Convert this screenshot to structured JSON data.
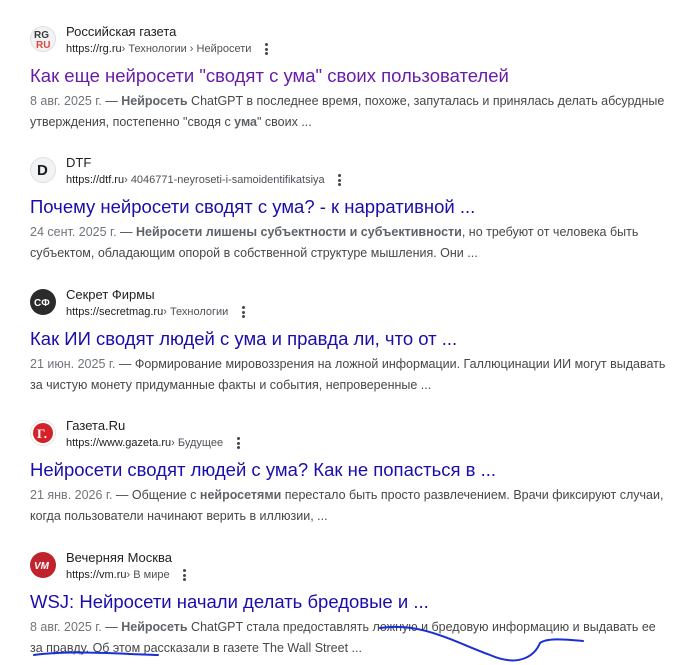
{
  "results": [
    {
      "site": "Российская газета",
      "url": "https://rg.ru",
      "breadcrumbs": " › Технологии › Нейросети",
      "favicon": "rg-logo",
      "favicon_text": [
        "RG",
        "RU"
      ],
      "title": "Как еще нейросети \"сводят с ума\" своих пользователей",
      "title_color": "#681da8",
      "date": "8 авг. 2025 г.",
      "dash": " — ",
      "snippet": [
        {
          "t": "Нейросеть",
          "b": true
        },
        {
          "t": " ChatGPT в последнее время, похоже, запуталась и принялась делать абсурдные утверждения, постепенно \"сводя с ",
          "b": false
        },
        {
          "t": "ума",
          "b": true
        },
        {
          "t": "\" своих ...",
          "b": false
        }
      ]
    },
    {
      "site": "DTF",
      "url": "https://dtf.ru",
      "breadcrumbs": " › 4046771-neyroseti-i-samoidentifikatsiya",
      "favicon": "dtf-logo",
      "favicon_text": [
        "D"
      ],
      "title": "Почему нейросети сводят с ума? - к нарративной ...",
      "title_color": "#1a0dab",
      "date": "24 сент. 2025 г.",
      "dash": " — ",
      "snippet": [
        {
          "t": "Нейросети лишены субъектности и субъективности",
          "b": true
        },
        {
          "t": ", но требуют от человека быть субъектом, обладающим опорой в собственной структуре мышления. Они ...",
          "b": false
        }
      ]
    },
    {
      "site": "Секрет Фирмы",
      "url": "https://secretmag.ru",
      "breadcrumbs": " › Технологии",
      "favicon": "sf-logo",
      "favicon_text": [
        "СФ"
      ],
      "title": "Как ИИ сводят людей с ума и правда ли, что от ...",
      "title_color": "#1a0dab",
      "date": "21 июн. 2025 г.",
      "dash": " — ",
      "snippet": [
        {
          "t": "Формирование мировоззрения на ложной информации. Галлюцинации ИИ могут выдавать за чистую монету придуманные факты и события, непроверенные ...",
          "b": false
        }
      ]
    },
    {
      "site": "Газета.Ru",
      "url": "https://www.gazeta.ru",
      "breadcrumbs": " › Будущее",
      "favicon": "gazeta-logo",
      "favicon_text": [
        "Г."
      ],
      "title": "Нейросети сводят людей с ума? Как не попасться в ...",
      "title_color": "#1a0dab",
      "date": "21 янв. 2026 г.",
      "dash": " — ",
      "snippet": [
        {
          "t": "Общение с ",
          "b": false
        },
        {
          "t": "нейросетями",
          "b": true
        },
        {
          "t": " перестало быть просто развлечением. Врачи фиксируют случаи, когда пользователи начинают верить в иллюзии, ...",
          "b": false
        }
      ]
    },
    {
      "site": "Вечерняя Москва",
      "url": "https://vm.ru",
      "breadcrumbs": " › В мире",
      "favicon": "vm-logo",
      "favicon_text": [
        "VM"
      ],
      "title": "WSJ: Нейросети начали делать бредовые и ...",
      "title_color": "#1a0dab",
      "date": "8 авг. 2025 г.",
      "dash": " — ",
      "snippet": [
        {
          "t": "Нейросеть",
          "b": true
        },
        {
          "t": " ChatGPT стала предоставлять ложную и бредовую информацию и выдавать ее за правду. Об этом рассказали в газете The Wall Street ...",
          "b": false
        }
      ]
    }
  ],
  "annotation": {
    "color": "#1a2fd6",
    "kind": "hand-drawn-underline"
  }
}
